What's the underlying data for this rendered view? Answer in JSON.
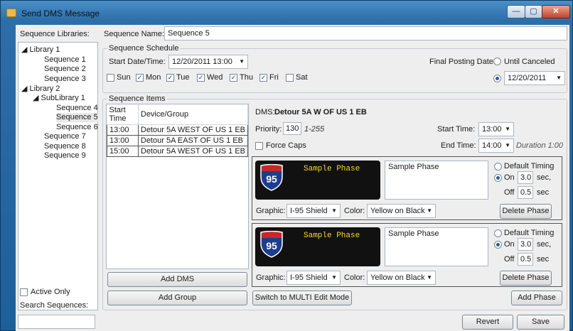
{
  "window": {
    "title": "Send DMS Message",
    "min": "—",
    "max": "▢",
    "close": "✕"
  },
  "left": {
    "libraries_label": "Sequence Libraries:",
    "tree": [
      {
        "label": "◢ Library 1",
        "level": 0
      },
      {
        "label": "Sequence 1",
        "level": 2
      },
      {
        "label": "Sequence 2",
        "level": 2
      },
      {
        "label": "Sequence 3",
        "level": 2
      },
      {
        "label": "◢ Library 2",
        "level": 0
      },
      {
        "label": "◢ SubLibrary 1",
        "level": 1
      },
      {
        "label": "Sequence 4",
        "level": 3
      },
      {
        "label": "Sequence 5",
        "level": 3,
        "selected": true
      },
      {
        "label": "Sequence 6",
        "level": 3
      },
      {
        "label": "Sequence 7",
        "level": 2
      },
      {
        "label": "Sequence 8",
        "level": 2
      },
      {
        "label": "Sequence 9",
        "level": 2
      }
    ],
    "active_only": "Active Only",
    "search_label": "Search Sequences:",
    "search_value": ""
  },
  "name": {
    "label": "Sequence Name:",
    "value": "Sequence 5"
  },
  "schedule": {
    "legend": "Sequence Schedule",
    "start_label": "Start Date/Time:",
    "start_value": "12/20/2011 13:00",
    "final_label": "Final Posting Date:",
    "until_canceled": "Until Canceled",
    "final_date": "12/20/2011",
    "days": [
      {
        "label": "Sun",
        "checked": false
      },
      {
        "label": "Mon",
        "checked": true
      },
      {
        "label": "Tue",
        "checked": true
      },
      {
        "label": "Wed",
        "checked": true
      },
      {
        "label": "Thu",
        "checked": true
      },
      {
        "label": "Fri",
        "checked": true
      },
      {
        "label": "Sat",
        "checked": false
      }
    ]
  },
  "items": {
    "legend": "Sequence Items",
    "columns": [
      "Start Time",
      "Device/Group"
    ],
    "rows": [
      [
        "13:00",
        "Detour 5A WEST OF US 1 EB"
      ],
      [
        "13:00",
        "Detour 5A EAST OF US 1 EB"
      ],
      [
        "15:00",
        "Detour 5A WEST OF US 1 EB"
      ]
    ],
    "add_dms": "Add DMS",
    "add_group": "Add Group"
  },
  "dms": {
    "label": "DMS:",
    "value": "Detour 5A W OF US 1 EB",
    "priority_label": "Priority:",
    "priority": "130",
    "priority_range": "1-255",
    "start_label": "Start Time:",
    "start": "13:00",
    "force_caps": "Force Caps",
    "end_label": "End Time:",
    "end": "14:00",
    "duration": "Duration 1:00"
  },
  "phases": [
    {
      "sign_text": "Sample Phase",
      "shield_number": "95",
      "text": "Sample Phase",
      "default_timing": "Default Timing",
      "on_label": "On",
      "on": "3.0",
      "on_unit": "sec,",
      "off_label": "Off",
      "off": "0.5",
      "off_unit": "sec",
      "graphic_label": "Graphic:",
      "graphic": "I-95 Shield",
      "color_label": "Color:",
      "color": "Yellow on Black",
      "delete": "Delete Phase"
    },
    {
      "sign_text": "Sample Phase",
      "shield_number": "95",
      "text": "Sample Phase",
      "default_timing": "Default Timing",
      "on_label": "On",
      "on": "3.0",
      "on_unit": "sec,",
      "off_label": "Off",
      "off": "0.5",
      "off_unit": "sec",
      "graphic_label": "Graphic:",
      "graphic": "I-95 Shield",
      "color_label": "Color:",
      "color": "Yellow on Black",
      "delete": "Delete Phase"
    }
  ],
  "footer": {
    "multi": "Switch to MULTI Edit Mode",
    "add_phase": "Add Phase",
    "revert": "Revert",
    "save": "Save"
  },
  "colors": {
    "sign_bg": "#111111",
    "sign_text": "#f4d92a",
    "shield_blue": "#1d3d8f",
    "shield_red": "#c62828"
  }
}
